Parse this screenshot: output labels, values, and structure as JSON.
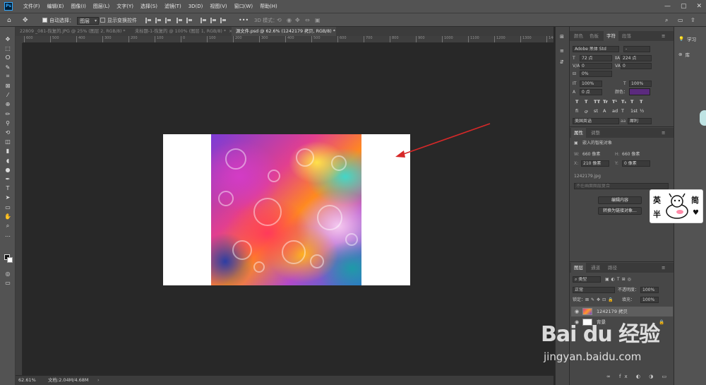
{
  "app": {
    "logo": "Ps"
  },
  "menubar": {
    "items": [
      "文件(F)",
      "编辑(E)",
      "图像(I)",
      "图层(L)",
      "文字(Y)",
      "选择(S)",
      "滤镜(T)",
      "3D(D)",
      "视图(V)",
      "窗口(W)",
      "帮助(H)"
    ],
    "window_controls": [
      "—",
      "▢",
      "✕"
    ]
  },
  "options": {
    "auto_select_label": "自动选择：",
    "auto_select_value": "图层",
    "show_transform_label": "显示变换控件",
    "more": "•••",
    "mode_3d": "3D 模式："
  },
  "tabs": [
    {
      "label": "22809 _081-恢复的.JPG @ 25% (图层 2, RGB/8) *",
      "close": "×"
    },
    {
      "label": "未标题-1-恢复的 @ 100% (图层 1, RGB/8) *",
      "close": "×"
    },
    {
      "label": "源文件.psd @ 62.6% (1242179 拷贝, RGB/8) *",
      "close": "×"
    }
  ],
  "ruler_ticks": [
    "600",
    "500",
    "400",
    "300",
    "200",
    "100",
    "0",
    "100",
    "200",
    "300",
    "400",
    "500",
    "600",
    "700",
    "800",
    "900",
    "1000",
    "1100",
    "1200",
    "1300",
    "1400",
    "1500"
  ],
  "status": {
    "zoom": "62.61%",
    "doc": "文档:2.04M/4.68M"
  },
  "character_panel": {
    "tabs": [
      "颜色",
      "色板",
      "字符",
      "段落"
    ],
    "active_tab": "字符",
    "font_family": "Adobe 黑体 Std",
    "font_style": "-",
    "font_size": "72 点",
    "leading": "224 点",
    "kerning": "0",
    "tracking": "0",
    "scale_pct": "0%",
    "vert_scale": "100%",
    "horiz_scale": "100%",
    "baseline": "0 点",
    "color_label": "颜色：",
    "text_color": "#5b2a7e",
    "style_buttons": [
      "T",
      "T",
      "TT",
      "Tr",
      "T¹",
      "T₁",
      "T",
      "T"
    ],
    "opentype_buttons": [
      "fi",
      "ꝍ",
      "st",
      "A",
      "ad",
      "T",
      "1st",
      "½"
    ],
    "language": "美国英语",
    "antialias_prefix": "aa",
    "antialias": "犀利"
  },
  "properties_panel": {
    "tabs": [
      "属性",
      "调整"
    ],
    "type_label": "嵌入的智能对象",
    "w_label": "W:",
    "w": "660 像素",
    "h_label": "H:",
    "h": "660 像素",
    "x_label": "X:",
    "x": "210 像素",
    "y_label": "Y:",
    "y": "0 像素",
    "filename": "1242179.jpg",
    "comp_placeholder": "不在画面图层复合",
    "edit_button": "编辑内容",
    "convert_button": "转换为链接对象..."
  },
  "layers_panel": {
    "tabs": [
      "图层",
      "通道",
      "路径"
    ],
    "filter_label": "类型",
    "blend_mode": "正常",
    "opacity_label": "不透明度：",
    "opacity": "100%",
    "lock_label": "锁定：",
    "fill_label": "填充：",
    "fill": "100%",
    "layers": [
      {
        "name": "1242179 拷贝",
        "selected": true
      },
      {
        "name": "背景",
        "selected": false
      }
    ]
  },
  "learn_panel": {
    "items": [
      "学习",
      "库"
    ]
  },
  "sticker": {
    "chars": [
      "英",
      "半",
      "简"
    ]
  },
  "watermark": {
    "main": "Bai du 经验",
    "sub": "jingyan.baidu.com"
  }
}
